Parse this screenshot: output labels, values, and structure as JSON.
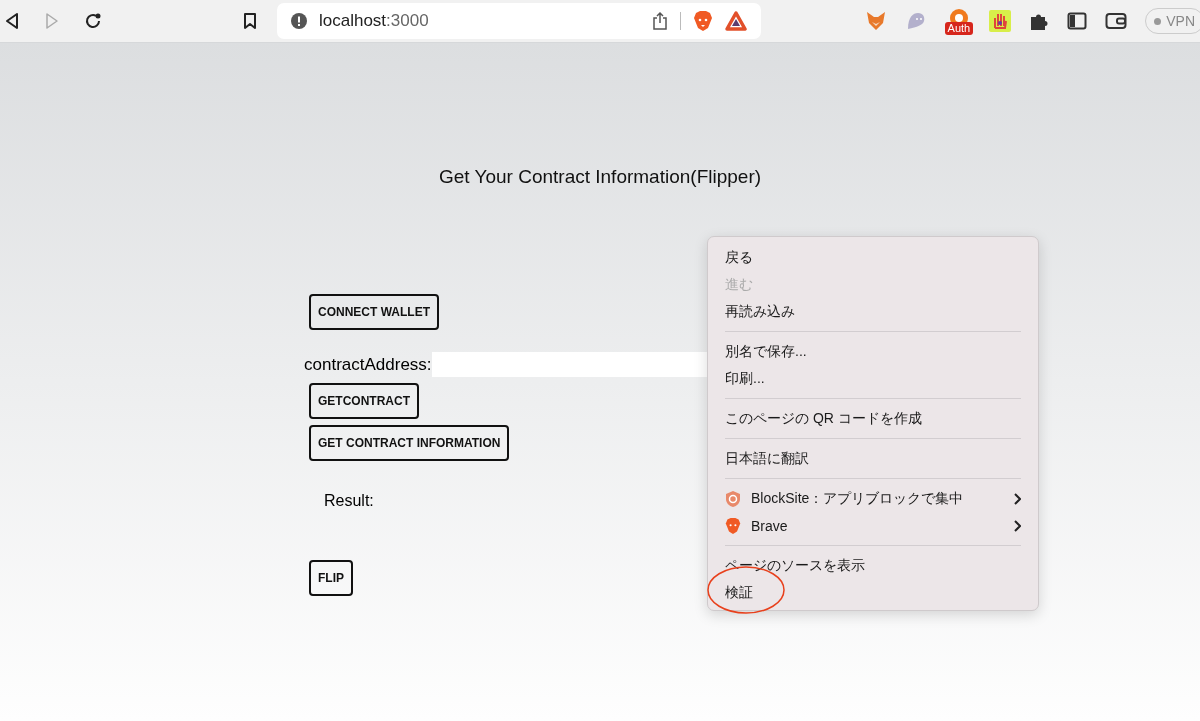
{
  "browser": {
    "url_host": "localhost",
    "url_port": ":3000",
    "auth_badge": "Auth",
    "vpn_label": "VPN"
  },
  "page": {
    "title": "Get Your Contract Information(Flipper)",
    "connect_button": "CONNECT WALLET",
    "address_label": "contractAddress:",
    "get_contract_button": "GETCONTRACT",
    "get_info_button": "GET CONTRACT INFORMATION",
    "result_label": "Result:",
    "flip_button": "FLIP"
  },
  "context_menu": {
    "groups": [
      [
        {
          "label": "戻る",
          "kind": "text",
          "disabled": false,
          "highlighted": false
        },
        {
          "label": "進む",
          "kind": "text",
          "disabled": true,
          "highlighted": false
        },
        {
          "label": "再読み込み",
          "kind": "text",
          "disabled": false,
          "highlighted": false
        }
      ],
      [
        {
          "label": "別名で保存...",
          "kind": "text",
          "disabled": false,
          "highlighted": false
        },
        {
          "label": "印刷...",
          "kind": "text",
          "disabled": false,
          "highlighted": false
        }
      ],
      [
        {
          "label": "このページの QR コードを作成",
          "kind": "text",
          "disabled": false,
          "highlighted": false
        }
      ],
      [
        {
          "label": "日本語に翻訳",
          "kind": "text",
          "disabled": false,
          "highlighted": false
        }
      ],
      [
        {
          "label": "BlockSite：アプリブロックで集中",
          "kind": "extension",
          "disabled": false,
          "highlighted": false
        },
        {
          "label": "Brave",
          "kind": "extension",
          "disabled": false,
          "highlighted": false
        }
      ],
      [
        {
          "label": "ページのソースを表示",
          "kind": "text",
          "disabled": false,
          "highlighted": false
        },
        {
          "label": "検証",
          "kind": "text",
          "disabled": false,
          "highlighted": true
        }
      ]
    ]
  }
}
